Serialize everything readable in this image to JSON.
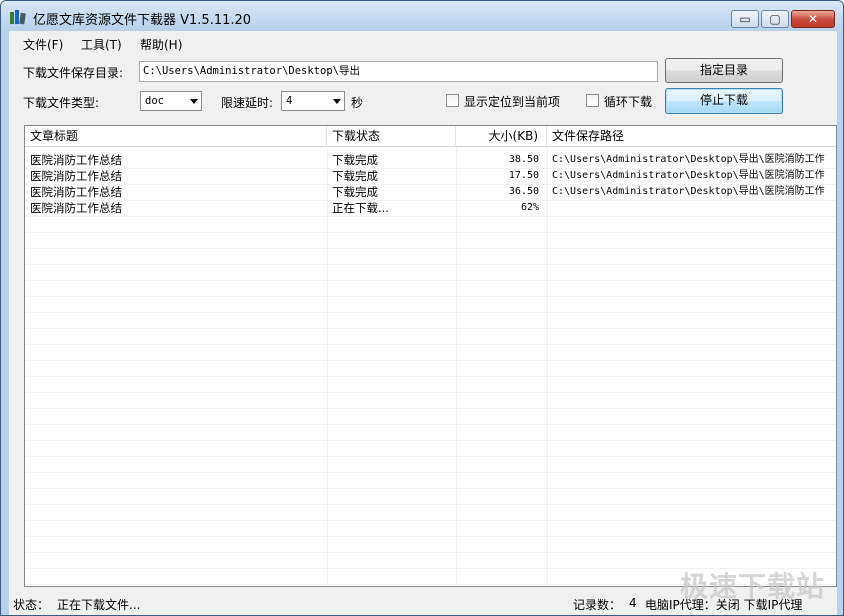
{
  "window": {
    "title": "亿愿文库资源文件下载器 V1.5.11.20",
    "minimize_glyph": "▭",
    "maximize_glyph": "▢",
    "close_glyph": "✕"
  },
  "menu": {
    "items": [
      {
        "label": "文件(F)"
      },
      {
        "label": "工具(T)"
      },
      {
        "label": "帮助(H)"
      }
    ]
  },
  "form": {
    "save_dir_label": "下载文件保存目录:",
    "save_dir_value": "C:\\Users\\Administrator\\Desktop\\导出",
    "set_dir_button": "指定目录",
    "file_type_label": "下载文件类型:",
    "file_type_value": "doc",
    "delay_label": "限速延时:",
    "delay_value": "4",
    "delay_unit": "秒",
    "locate_current_label": "显示定位到当前项",
    "loop_download_label": "循环下载",
    "stop_button": "停止下载"
  },
  "table": {
    "columns": [
      {
        "label": "文章标题"
      },
      {
        "label": "下载状态"
      },
      {
        "label": "大小(KB)"
      },
      {
        "label": "文件保存路径"
      }
    ],
    "rows": [
      {
        "title": "医院消防工作总结",
        "status": "下载完成",
        "size": "38.50",
        "path": "C:\\Users\\Administrator\\Desktop\\导出\\医院消防工作"
      },
      {
        "title": "医院消防工作总结",
        "status": "下载完成",
        "size": "17.50",
        "path": "C:\\Users\\Administrator\\Desktop\\导出\\医院消防工作"
      },
      {
        "title": "医院消防工作总结",
        "status": "下载完成",
        "size": "36.50",
        "path": "C:\\Users\\Administrator\\Desktop\\导出\\医院消防工作"
      },
      {
        "title": "医院消防工作总结",
        "status": "正在下载...",
        "size": "62%",
        "path": ""
      }
    ]
  },
  "status": {
    "state_label": "状态：",
    "state_value": "正在下载文件...",
    "records_label": "记录数：",
    "records_value": "4",
    "proxy_text": "电脑IP代理：关闭  下载IP代理"
  },
  "watermark": "极速下载站"
}
